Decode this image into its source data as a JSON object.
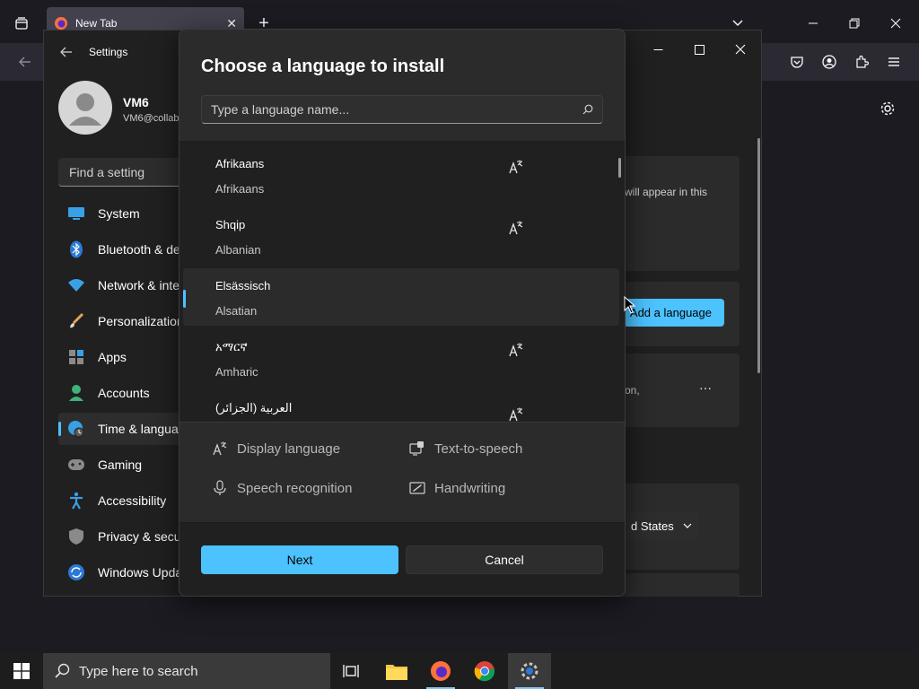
{
  "browser": {
    "tab_title": "New Tab",
    "new_tab_symbol": "+",
    "icons": [
      "tab-list-icon",
      "firefox-icon",
      "close-icon",
      "new-tab-icon",
      "chevron-down-icon",
      "minimize-icon",
      "restore-icon",
      "close-icon",
      "back-icon",
      "pocket-icon",
      "account-icon",
      "extensions-icon",
      "menu-icon",
      "settings-gear-icon"
    ]
  },
  "settings_window": {
    "title": "Settings",
    "user": {
      "name": "VM6",
      "email": "VM6@collab"
    },
    "search_placeholder": "Find a setting",
    "nav": [
      {
        "label": "System",
        "icon": "monitor-icon"
      },
      {
        "label": "Bluetooth & de",
        "icon": "bluetooth-icon"
      },
      {
        "label": "Network & inte",
        "icon": "wifi-icon"
      },
      {
        "label": "Personalization",
        "icon": "brush-icon"
      },
      {
        "label": "Apps",
        "icon": "apps-icon"
      },
      {
        "label": "Accounts",
        "icon": "person-icon"
      },
      {
        "label": "Time & langua",
        "icon": "globe-clock-icon",
        "active": true
      },
      {
        "label": "Gaming",
        "icon": "gamepad-icon"
      },
      {
        "label": "Accessibility",
        "icon": "accessibility-icon"
      },
      {
        "label": "Privacy & secur",
        "icon": "shield-icon"
      },
      {
        "label": "Windows Upda",
        "icon": "update-icon"
      }
    ],
    "right_panel": {
      "card_text": "will appear in this",
      "add_language_label": "Add a language",
      "partial_text": "on,",
      "more_symbol": "···",
      "region_value": "d States"
    }
  },
  "dialog": {
    "title": "Choose a language to install",
    "search_placeholder": "Type a language name...",
    "languages": [
      {
        "native": "Afrikaans",
        "english": "Afrikaans",
        "has_display_feature": true
      },
      {
        "native": "Shqip",
        "english": "Albanian",
        "has_display_feature": true
      },
      {
        "native": "Elsässisch",
        "english": "Alsatian",
        "has_display_feature": false,
        "selected": true
      },
      {
        "native": "አማርኛ",
        "english": "Amharic",
        "has_display_feature": true
      },
      {
        "native": "العربية (الجزائر)",
        "english": "",
        "has_display_feature": true
      }
    ],
    "legend": {
      "display_language": "Display language",
      "text_to_speech": "Text-to-speech",
      "speech_recognition": "Speech recognition",
      "handwriting": "Handwriting"
    },
    "next_label": "Next",
    "cancel_label": "Cancel"
  },
  "taskbar": {
    "search_placeholder": "Type here to search",
    "apps": [
      "task-view-icon",
      "file-explorer-icon",
      "firefox-icon",
      "chrome-icon",
      "settings-icon"
    ]
  },
  "colors": {
    "accent": "#4cc2ff",
    "dialog_bg": "#2b2b2b",
    "window_bg": "#202020"
  }
}
